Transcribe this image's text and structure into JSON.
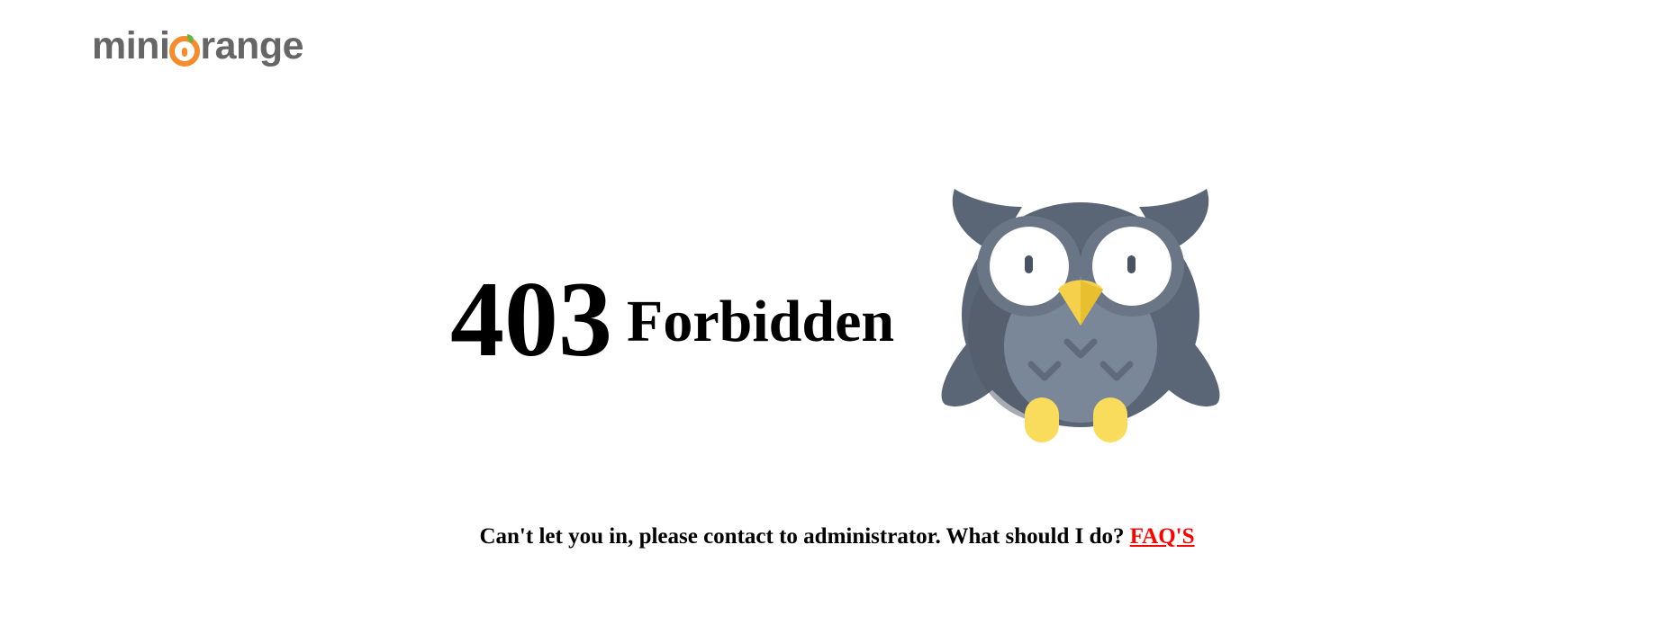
{
  "logo": {
    "prefix": "mini",
    "suffix": "range"
  },
  "error": {
    "code": "403",
    "title": "Forbidden"
  },
  "message": {
    "text": "Can't let you in, please contact to administrator. What should I do?",
    "link_label": "FAQ'S"
  },
  "colors": {
    "logo_text": "#666666",
    "logo_accent": "#f58d2e",
    "link": "#ff0000",
    "owl_body": "#5a6575",
    "owl_belly": "#7a8799",
    "owl_beak": "#f5d04a",
    "owl_feet": "#f9dc5c"
  }
}
